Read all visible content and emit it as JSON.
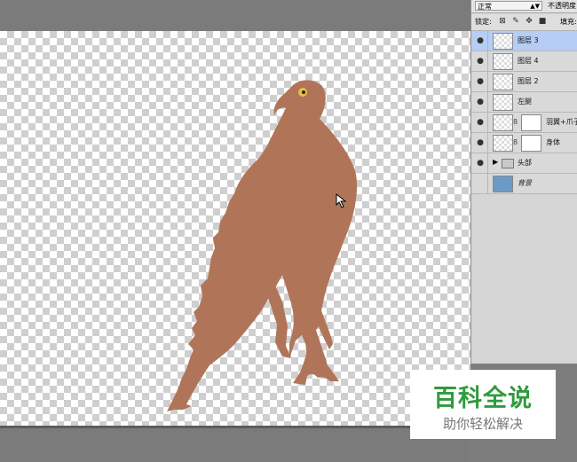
{
  "layers_panel": {
    "blend_mode": "正常",
    "opacity_label": "不透明度",
    "lock_label": "锁定:",
    "fill_label": "填充:",
    "layers": [
      {
        "name": "图层 3",
        "visible": true,
        "selected": true,
        "type": "pixel"
      },
      {
        "name": "图层 4",
        "visible": true,
        "selected": false,
        "type": "pixel"
      },
      {
        "name": "图层 2",
        "visible": true,
        "selected": false,
        "type": "pixel"
      },
      {
        "name": "左腿",
        "visible": true,
        "selected": false,
        "type": "pixel"
      },
      {
        "name": "羽翼+爪子",
        "visible": true,
        "selected": false,
        "type": "masked"
      },
      {
        "name": "身体",
        "visible": true,
        "selected": false,
        "type": "masked"
      },
      {
        "name": "头部",
        "visible": true,
        "selected": false,
        "type": "group"
      },
      {
        "name": "背景",
        "visible": false,
        "selected": false,
        "type": "background"
      }
    ]
  },
  "canvas": {
    "bird_color": "#b07559",
    "eye_color": "#e8c13a"
  },
  "watermark": {
    "title": "百科全说",
    "subtitle": "助你轻松解决"
  }
}
